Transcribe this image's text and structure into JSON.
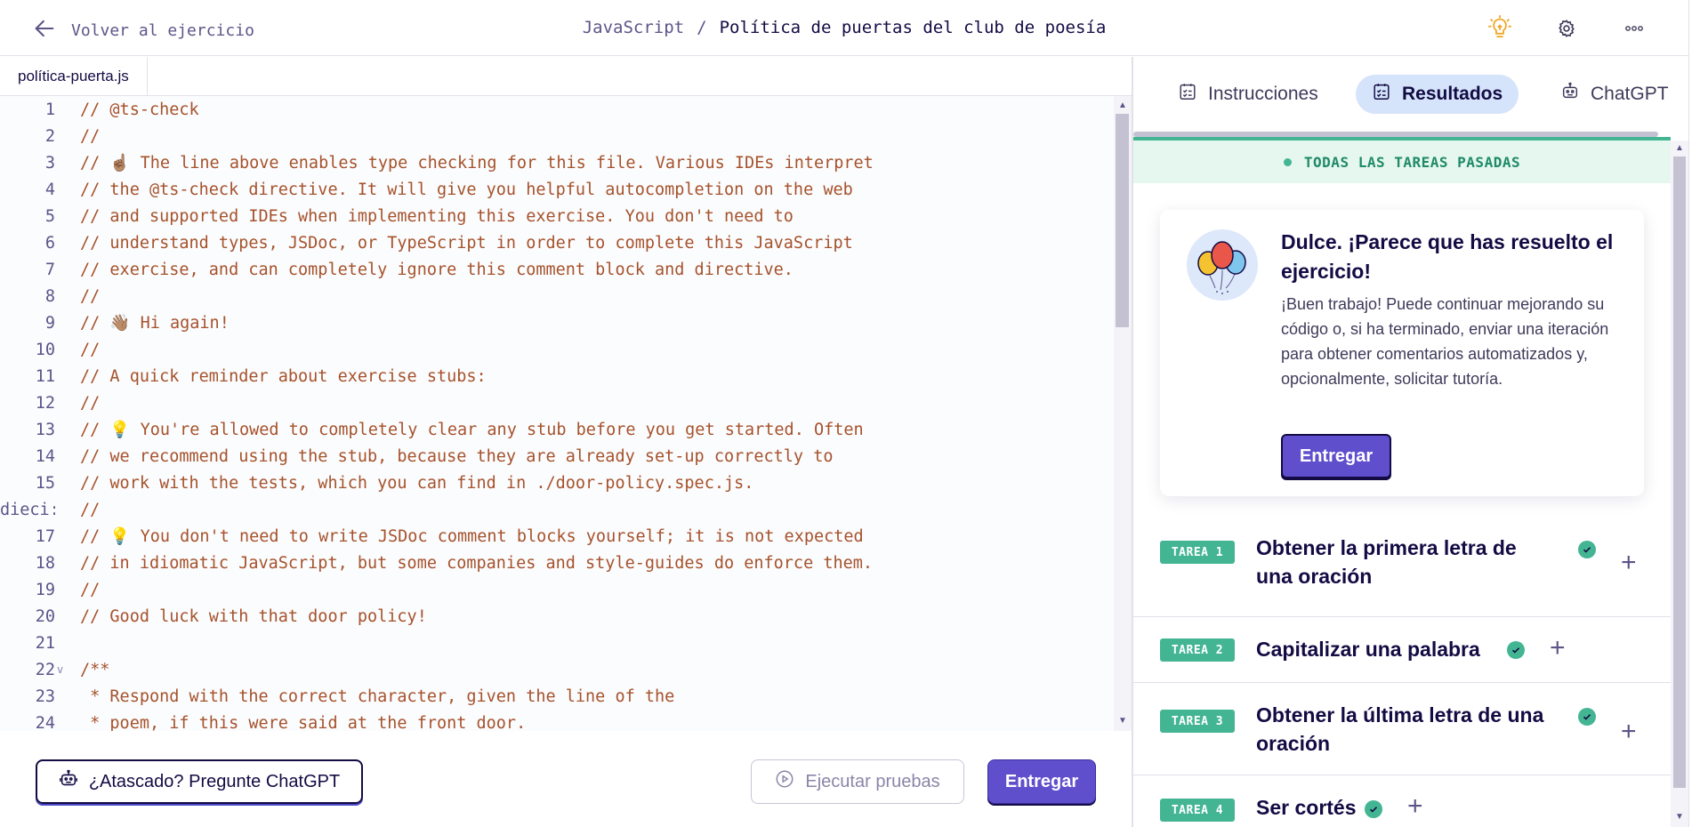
{
  "header": {
    "back_label": "Volver al ejercicio",
    "track": "JavaScript",
    "separator": "/",
    "exercise": "Política de puertas del club de poesía"
  },
  "editor": {
    "file_tab": "política-puerta.js",
    "lines": [
      {
        "n": "1",
        "text": "// @ts-check"
      },
      {
        "n": "2",
        "text": "//"
      },
      {
        "n": "3",
        "text": "// ☝🏽 The line above enables type checking for this file. Various IDEs interpret"
      },
      {
        "n": "4",
        "text": "// the @ts-check directive. It will give you helpful autocompletion on the web"
      },
      {
        "n": "5",
        "text": "// and supported IDEs when implementing this exercise. You don't need to"
      },
      {
        "n": "6",
        "text": "// understand types, JSDoc, or TypeScript in order to complete this JavaScript"
      },
      {
        "n": "7",
        "text": "// exercise, and can completely ignore this comment block and directive."
      },
      {
        "n": "8",
        "text": "//"
      },
      {
        "n": "9",
        "text": "// 👋🏽 Hi again!"
      },
      {
        "n": "10",
        "text": "//"
      },
      {
        "n": "11",
        "text": "// A quick reminder about exercise stubs:"
      },
      {
        "n": "12",
        "text": "//"
      },
      {
        "n": "13",
        "text": "// 💡 You're allowed to completely clear any stub before you get started. Often"
      },
      {
        "n": "14",
        "text": "// we recommend using the stub, because they are already set-up correctly to"
      },
      {
        "n": "15",
        "text": "// work with the tests, which you can find in ./door-policy.spec.js."
      },
      {
        "n": "dieci:",
        "text": "//"
      },
      {
        "n": "17",
        "text": "// 💡 You don't need to write JSDoc comment blocks yourself; it is not expected"
      },
      {
        "n": "18",
        "text": "// in idiomatic JavaScript, but some companies and style-guides do enforce them."
      },
      {
        "n": "19",
        "text": "//"
      },
      {
        "n": "20",
        "text": "// Good luck with that door policy!"
      },
      {
        "n": "21",
        "text": ""
      },
      {
        "n": "22",
        "text": "/**",
        "fold": "v"
      },
      {
        "n": "23",
        "text": " * Respond with the correct character, given the line of the"
      },
      {
        "n": "24",
        "text": " * poem, if this were said at the front door."
      }
    ],
    "chatgpt_button": "¿Atascado? Pregunte ChatGPT",
    "run_button": "Ejecutar pruebas",
    "submit_button": "Entregar"
  },
  "panel": {
    "tabs": [
      {
        "label": "Instrucciones",
        "icon": "checklist-icon",
        "active": false
      },
      {
        "label": "Resultados",
        "icon": "checklist-icon",
        "active": true
      },
      {
        "label": "ChatGPT",
        "icon": "robot-icon",
        "active": false
      }
    ],
    "status": "TODAS LAS TAREAS PASADAS",
    "success_title": "Dulce. ¡Parece que has resuelto el ejercicio!",
    "success_body": "¡Buen trabajo! Puede continuar mejorando su código o, si ha terminado, enviar una iteración para obtener comentarios automatizados y, opcionalmente, solicitar tutoría.",
    "success_button": "Entregar",
    "tasks": [
      {
        "badge": "TAREA 1",
        "title": "Obtener la primera letra de una oración"
      },
      {
        "badge": "TAREA 2",
        "title": "Capitalizar una palabra"
      },
      {
        "badge": "TAREA 3",
        "title": "Obtener la última letra de una oración"
      },
      {
        "badge": "TAREA 4",
        "title": "Ser cortés"
      }
    ]
  },
  "colors": {
    "accent": "#604fcd",
    "success": "#43b593",
    "code": "#a6522b",
    "text": "#130b43"
  }
}
